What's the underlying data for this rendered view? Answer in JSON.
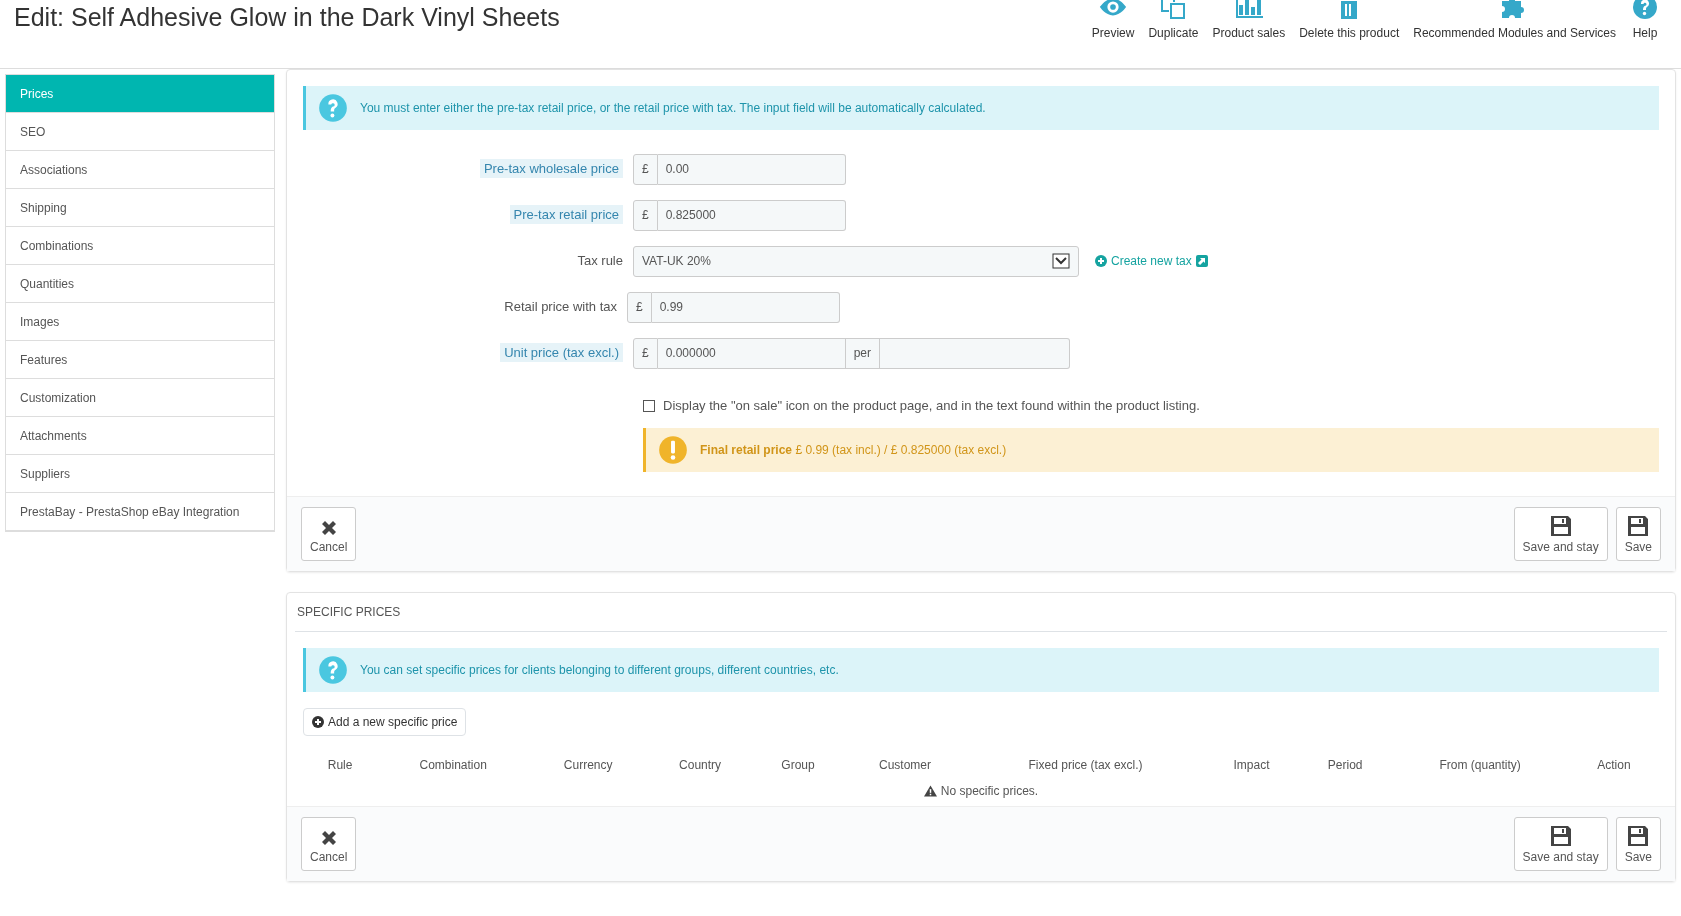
{
  "page_title": "Edit: Self Adhesive Glow in the Dark Vinyl Sheets",
  "toolbar": [
    {
      "kind": "preview",
      "label": "Preview"
    },
    {
      "kind": "duplicate",
      "label": "Duplicate"
    },
    {
      "kind": "sales",
      "label": "Product sales"
    },
    {
      "kind": "delete",
      "label": "Delete this product"
    },
    {
      "kind": "modules",
      "label": "Recommended Modules and Services"
    },
    {
      "kind": "help",
      "label": "Help"
    }
  ],
  "sidebar": {
    "items": [
      {
        "label": "Prices",
        "selected": true
      },
      {
        "label": "SEO",
        "selected": false
      },
      {
        "label": "Associations",
        "selected": false
      },
      {
        "label": "Shipping",
        "selected": false
      },
      {
        "label": "Combinations",
        "selected": false
      },
      {
        "label": "Quantities",
        "selected": false
      },
      {
        "label": "Images",
        "selected": false
      },
      {
        "label": "Features",
        "selected": false
      },
      {
        "label": "Customization",
        "selected": false
      },
      {
        "label": "Attachments",
        "selected": false
      },
      {
        "label": "Suppliers",
        "selected": false
      },
      {
        "label": "PrestaBay - PrestaShop eBay Integration",
        "selected": false
      }
    ]
  },
  "prices_panel": {
    "info": "You must enter either the pre-tax retail price, or the retail price with tax. The input field will be automatically calculated.",
    "fields": [
      {
        "kind": "money",
        "label": "Pre-tax wholesale price",
        "has_help": true,
        "currency": "£",
        "value": "0.00"
      },
      {
        "kind": "money",
        "label": "Pre-tax retail price",
        "has_help": true,
        "currency": "£",
        "value": "0.825000"
      },
      {
        "kind": "select",
        "label": "Tax rule",
        "has_help": false,
        "value": "VAT-UK 20%",
        "link": "Create new tax"
      },
      {
        "kind": "money",
        "label": "Retail price with tax",
        "has_help": false,
        "currency": "£",
        "value": "0.99"
      },
      {
        "kind": "unit",
        "label": "Unit price (tax excl.)",
        "has_help": true,
        "currency": "£",
        "value": "0.000000",
        "per": "per"
      }
    ],
    "on_sale": {
      "label": "Display the \"on sale\" icon on the product page, and in the text found within the product listing.",
      "checked": false
    },
    "warning": "**Final retail price** £ 0.99 (tax incl.) / £ 0.825000 (tax excl.)",
    "footer": {
      "cancel": "Cancel",
      "save_and_stay": "Save and stay",
      "save": "Save"
    }
  },
  "specific_prices_panel": {
    "heading": "SPECIFIC PRICES",
    "info": "You can set specific prices for clients belonging to different groups, different countries, etc.",
    "add_button": "Add a new specific price",
    "table": {
      "columns": [
        "Rule",
        "Combination",
        "Currency",
        "Country",
        "Group",
        "Customer",
        "Fixed price (tax excl.)",
        "Impact",
        "Period",
        "From (quantity)",
        "Action"
      ],
      "empty_message": "No specific prices."
    },
    "footer": {
      "cancel": "Cancel",
      "save_and_stay": "Save and stay",
      "save": "Save"
    }
  }
}
